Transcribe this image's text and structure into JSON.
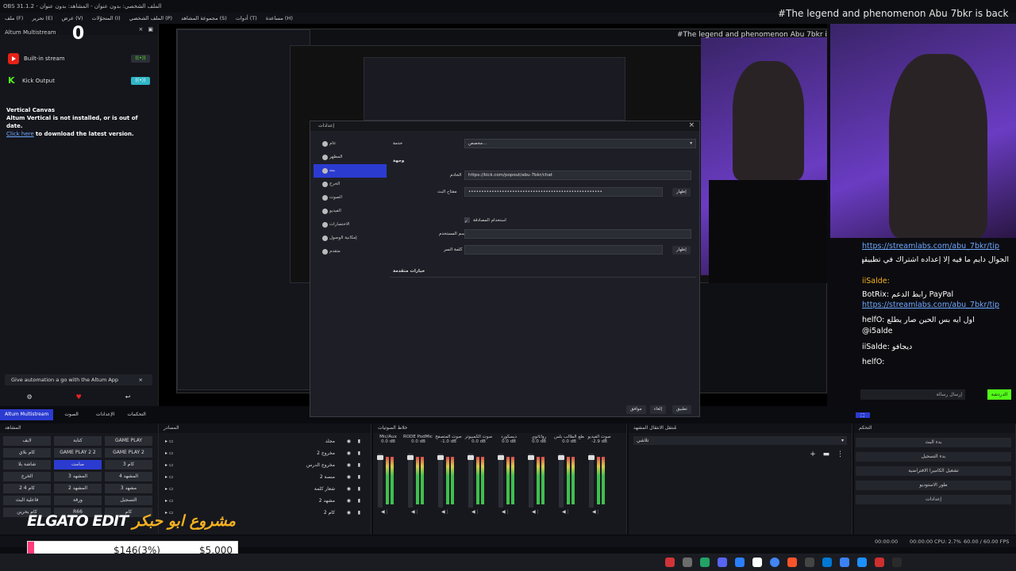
{
  "window": {
    "title": "OBS 31.1.2 - الملف الشخصي: بدون عنوان - المشاهد: بدون عنوان"
  },
  "menu": [
    "ملف (F)",
    "تحرير (E)",
    "عرض (V)",
    "المتحوّلات (I)",
    "الملف الشخصي (P)",
    "مجموعة المشاهد (S)",
    "أدوات (T)",
    "مساعدة (H)"
  ],
  "altum": {
    "dock_title": "Altum Multistream",
    "counter": "0",
    "outputs": [
      {
        "name": "Built-in stream",
        "status": "off"
      },
      {
        "name": "Kick Output",
        "status": "on"
      }
    ],
    "vertical_title": "Vertical Canvas",
    "vertical_msg": "Altum Vertical is not installed, or is out of date.",
    "vertical_link": "Click here",
    "vertical_link_rest": "to download the latest version.",
    "promo": "Give automation a go with the Altum App",
    "tabs": [
      "Altum Multistream",
      "الصوت",
      "الإعدادات",
      "التحكمات"
    ]
  },
  "preview": {
    "overlay_headline": "#The legend and phenomenon Abu 7bkr is back"
  },
  "settings_dialog": {
    "title": "إعدادات",
    "sidebar": [
      "عام",
      "المظهر",
      "بث",
      "الخرج",
      "الصوت",
      "الفيديو",
      "الاختصارات",
      "إمكانية الوصول",
      "متقدم"
    ],
    "selected_index": 2,
    "service_label": "خدمة",
    "service_value": "مخصص...",
    "destination_label": "وجهة",
    "server_label": "الخادم",
    "server_value": "https://kick.com/popout/abu-7bkr/chat",
    "stream_key_label": "مفتاح البث",
    "stream_key_value": "••••••••••••••••••••••••••••••••••••••••••••••••••••",
    "show_button": "إظهار",
    "use_auth_label": "استخدام المصادقة",
    "username_label": "اسم المستخدم",
    "password_label": "كلمة السر",
    "advanced_label": "خيارات متقدمة",
    "buttons": [
      "تطبيق",
      "إلغاء",
      "موافق"
    ]
  },
  "chat": {
    "lines": [
      {
        "text": "https://streamlabs.com/abu_7bkr/tip",
        "link": true
      },
      {
        "text": "الجوال دايم ما فيه إلا إعداده اشتراك في تطبيقهم",
        "link": false
      },
      {
        "text": "iiSalde:",
        "link": false
      },
      {
        "text": "BotRix: رابط الدعم PayPal",
        "link": false
      },
      {
        "text": "https://streamlabs.com/abu_7bkr/tip",
        "link": true
      },
      {
        "text": "helfO: اول ايه بس الحين صار يطلع",
        "link": false
      },
      {
        "text": "@i5alde",
        "link": false
      },
      {
        "text": "iiSalde: ديجافو",
        "link": false
      },
      {
        "text": "helfO:",
        "link": false
      }
    ],
    "send_placeholder": "إرسال رسالة",
    "chat_button": "الدردشة"
  },
  "docks": {
    "scenes_title": "المشاهد",
    "scenes": [
      "لايف",
      "كتابة",
      "GAME PLAY",
      "كام بلاي",
      "GAME PLAY 2 2",
      "GAME PLAY 2",
      "شاشة بلا",
      "صامت",
      "3 كام",
      "الخرج",
      "3 المشهد",
      "4 المشهد",
      "2 4 كام",
      "2 المشهد",
      "3 مشهد",
      "فاعلية البث",
      "ورقة",
      "التسجيل",
      "كام بحرين",
      "R66",
      "كام"
    ],
    "active_scene_index": 7,
    "sources_title": "المصادر",
    "sources": [
      "مجلد",
      "مخروج 2",
      "مخروج الدرس",
      "منصة 2",
      "شعار كلمة",
      "مشهد 2",
      "كام 2"
    ],
    "mixer_title": "خلاط الصوتيات",
    "mixer": [
      {
        "name": "Mic/Aux",
        "db": "0.0 dB"
      },
      {
        "name": "RODE PodMic XLR",
        "db": "0.0 dB"
      },
      {
        "name": "صوت المتصفح",
        "db": "-1.0 dB"
      },
      {
        "name": "صوت الكمبيوتر",
        "db": "0.0 dB"
      },
      {
        "name": "ديسكورد",
        "db": "0.0 dB"
      },
      {
        "name": "رواتاتوي",
        "db": "0.0 dB"
      },
      {
        "name": "مقطع الطالب بلس",
        "db": "0.0 dB"
      },
      {
        "name": "صوت الفيديو",
        "db": "-2.9 dB"
      }
    ],
    "transition_title": "مُنتقل الانتقال المشهد",
    "transition_value": "تلاشي",
    "controls_title": "التحكم",
    "controls": [
      "بدء البث",
      "بدء التسجيل",
      "تشغيل الكاميرا الافتراضية",
      "طور الاستوديو",
      "إعدادات"
    ]
  },
  "status": {
    "time1": "00:00:00",
    "time2": "00:00:00",
    "cpu": "CPU: 2.7%",
    "fps": "60.00 / 60.00 FPS"
  },
  "overlay": {
    "brand": "ELGATO EDIT",
    "arabic_brand": "مشروع ابو حبكر",
    "goal_current": "$146(3%)",
    "goal_total": "$5,000",
    "goal_fraction": 0.03
  },
  "colors": {
    "selection": "#2b3bd0",
    "kick_green": "#53fc18",
    "youtube_red": "#e62117",
    "goal_fill": "#ff3b7a"
  }
}
